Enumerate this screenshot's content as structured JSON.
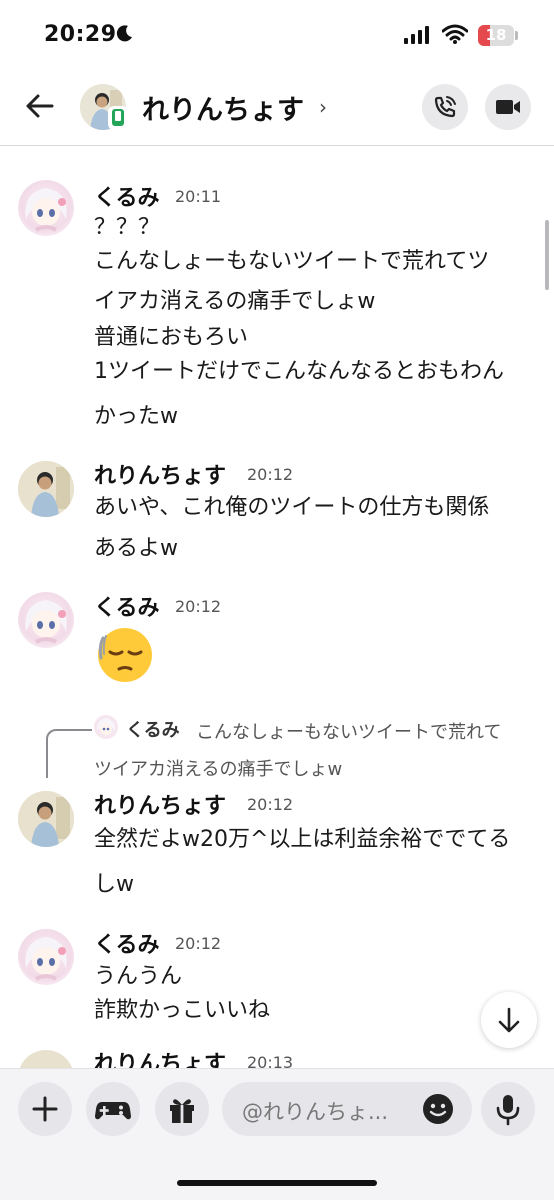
{
  "status_bar": {
    "time": "20:29",
    "battery": "18"
  },
  "header": {
    "name": "れりんちょす",
    "chevron": "›"
  },
  "messages": [
    {
      "user": "くるみ",
      "time": "20:11",
      "lines": [
        "？？？",
        "こんなしょーもないツイートで荒れてツ",
        "イアカ消えるの痛手でしょw",
        "普通におもろい",
        "1ツイートだけでこんなんなるとおもわん",
        "かったw"
      ]
    },
    {
      "user": "れりんちょす",
      "time": "20:12",
      "lines": [
        "あいや、これ俺のツイートの仕方も関係",
        "あるよw"
      ]
    },
    {
      "user": "くるみ",
      "time": "20:12",
      "emoji": "😔"
    },
    {
      "reply": {
        "user": "くるみ",
        "text1": "こんなしょーもないツイートで荒れて",
        "text2": "ツイアカ消えるの痛手でしょw"
      },
      "user": "れりんちょす",
      "time": "20:12",
      "lines": [
        "全然だよw20万^以上は利益余裕ででてる",
        "しw"
      ]
    },
    {
      "user": "くるみ",
      "time": "20:12",
      "lines": [
        "うんうん",
        "詐欺かっこいいね"
      ]
    },
    {
      "user": "れりんちょす",
      "time": "20:13"
    }
  ],
  "composer": {
    "placeholder": "@れりんちょ..."
  },
  "colors": {
    "online_badge": "#23a55a",
    "battery_low": "#e5484d"
  }
}
